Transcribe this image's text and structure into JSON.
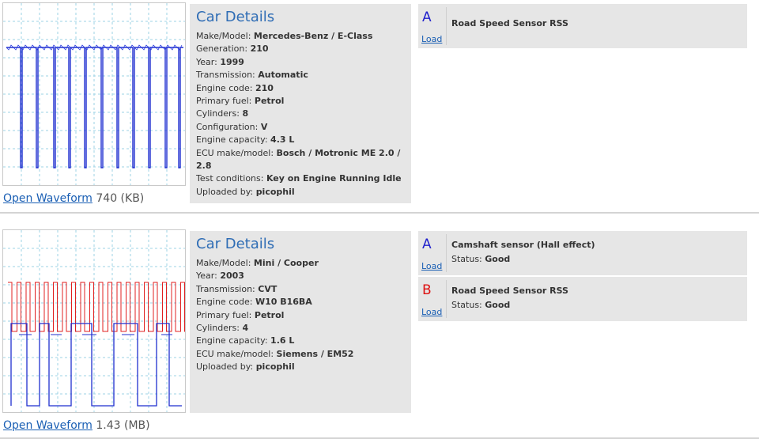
{
  "entries": [
    {
      "thumbnail_icon": "waveform-blue-icon",
      "open_link": "Open Waveform",
      "file_size": "740 (KB)",
      "details_title": "Car Details",
      "details": [
        {
          "label": "Make/Model:",
          "value": "Mercedes-Benz / E-Class"
        },
        {
          "label": "Generation:",
          "value": "210"
        },
        {
          "label": "Year:",
          "value": "1999"
        },
        {
          "label": "Transmission:",
          "value": "Automatic"
        },
        {
          "label": "Engine code:",
          "value": "210"
        },
        {
          "label": "Primary fuel:",
          "value": "Petrol"
        },
        {
          "label": "Cylinders:",
          "value": "8"
        },
        {
          "label": "Configuration:",
          "value": "V"
        },
        {
          "label": "Engine capacity:",
          "value": "4.3 L"
        },
        {
          "label": "ECU make/model:",
          "value": "Bosch / Motronic ME 2.0 / 2.8"
        },
        {
          "label": "Test conditions:",
          "value": "Key on Engine Running Idle"
        },
        {
          "label": "Uploaded by:",
          "value": "picophil"
        }
      ],
      "channels": [
        {
          "letter": "A",
          "load": "Load",
          "name": "Road Speed Sensor RSS",
          "status_label": "",
          "status_value": "",
          "color": "#2222cc"
        }
      ]
    },
    {
      "thumbnail_icon": "waveform-red-blue-icon",
      "open_link": "Open Waveform",
      "file_size": "1.43 (MB)",
      "details_title": "Car Details",
      "details": [
        {
          "label": "Make/Model:",
          "value": "Mini / Cooper"
        },
        {
          "label": "Year:",
          "value": "2003"
        },
        {
          "label": "Transmission:",
          "value": "CVT"
        },
        {
          "label": "Engine code:",
          "value": "W10 B16BA"
        },
        {
          "label": "Primary fuel:",
          "value": "Petrol"
        },
        {
          "label": "Cylinders:",
          "value": "4"
        },
        {
          "label": "Engine capacity:",
          "value": "1.6 L"
        },
        {
          "label": "ECU make/model:",
          "value": "Siemens / EM52"
        },
        {
          "label": "Uploaded by:",
          "value": "picophil"
        }
      ],
      "channels": [
        {
          "letter": "A",
          "load": "Load",
          "name": "Camshaft sensor (Hall effect)",
          "status_label": "Status:",
          "status_value": "Good",
          "color": "#2222cc"
        },
        {
          "letter": "B",
          "load": "Load",
          "name": "Road Speed Sensor RSS",
          "status_label": "Status:",
          "status_value": "Good",
          "color": "#dd1111"
        }
      ]
    }
  ]
}
